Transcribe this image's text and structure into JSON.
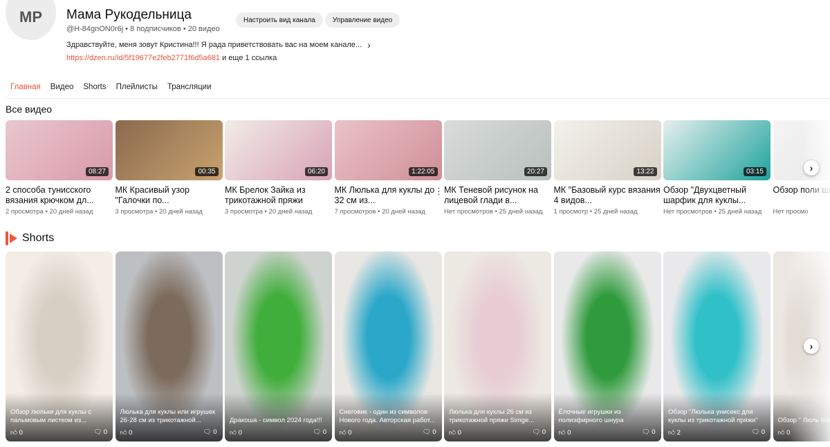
{
  "channel": {
    "initials": "МР",
    "name": "Мама Рукодельница",
    "handle": "@H-84gnON0r6j",
    "subscribers": "8 подписчиков",
    "video_count": "20 видео",
    "description": "Здравствуйте, меня зовут Кристина!!! Я рада приветствовать вас на моем канале...",
    "link": "https://dzen.ru/id/5f19677e2feb2771f6d5a681",
    "more_links": "и еще 1 ссылка",
    "customize_label": "Настроить вид канала",
    "manage_label": "Управление видео"
  },
  "tabs": [
    {
      "label": "Главная",
      "active": true
    },
    {
      "label": "Видео"
    },
    {
      "label": "Shorts"
    },
    {
      "label": "Плейлисты"
    },
    {
      "label": "Трансляции"
    }
  ],
  "videos_section": {
    "title": "Все видео",
    "items": [
      {
        "title": "2 способа тунисского вязания крючком дл...",
        "duration": "08:27",
        "views": "2 просмотра",
        "age": "20 дней назад",
        "colors": [
          "#e9c7cf",
          "#d99aa9"
        ]
      },
      {
        "title": "МК Красивый узор \"Галочки по...",
        "duration": "00:35",
        "views": "3 просмотра",
        "age": "20 дней назад",
        "colors": [
          "#8b6a4e",
          "#c8a36e"
        ]
      },
      {
        "title": "МК Брелок Зайка из трикотажной пряжи",
        "duration": "06:20",
        "views": "3 просмотра",
        "age": "20 дней назад",
        "colors": [
          "#f1ece6",
          "#d9a3b8"
        ]
      },
      {
        "title": "МК Люлька для куклы до 32 см из...",
        "duration": "1:22:05",
        "views": "7 просмотров",
        "age": "20 дней назад",
        "colors": [
          "#eac3c8",
          "#cf8f97"
        ]
      },
      {
        "title": "МК Теневой рисунок на лицевой глади в...",
        "duration": "20:27",
        "views": "Нет просмотров",
        "age": "25 дней назад",
        "colors": [
          "#d8dcda",
          "#b9c0bd"
        ]
      },
      {
        "title": "МК \"Базовый курс вязания 4 видов...",
        "duration": "13:22",
        "views": "1 просмотр",
        "age": "25 дней назад",
        "colors": [
          "#f3f1ec",
          "#d8d2c6"
        ]
      },
      {
        "title": "Обзор \"Двухцветный шарфик для куклы...",
        "duration": "03:15",
        "views": "Нет просмотров",
        "age": "25 дней назад",
        "colors": [
          "#e6efee",
          "#1fa39c"
        ]
      },
      {
        "title": "Обзор поли шнура Дар...",
        "duration": "",
        "views": "Нет просмо",
        "age": "",
        "colors": [
          "#f4f4f4",
          "#e6e6e6"
        ]
      }
    ]
  },
  "shorts_section": {
    "title": "Shorts",
    "items": [
      {
        "title": "Обзор люльки для куклы с пальмовым листком из...",
        "likes": "0",
        "comments": "0",
        "colors": [
          "#f3ede6",
          "#d8cfc4"
        ]
      },
      {
        "title": "Люлька для куклы или игрушек 26-28 см из трикотажной...",
        "likes": "0",
        "comments": "0",
        "colors": [
          "#bdbfc2",
          "#7c6b5c"
        ]
      },
      {
        "title": "Дракоша - символ 2024 года!!!",
        "likes": "0",
        "comments": "0",
        "colors": [
          "#cfd3cf",
          "#3fae3a"
        ]
      },
      {
        "title": "Снеговик - один из символов Нового года. Авторская работ...",
        "likes": "0",
        "comments": "0",
        "colors": [
          "#e8e7e3",
          "#2aa7c9"
        ]
      },
      {
        "title": "Люлька для куклы 26 см из трикотажной пряжи Simge...",
        "likes": "0",
        "comments": "0",
        "colors": [
          "#ece8e2",
          "#e8cdd4"
        ]
      },
      {
        "title": "Ёлочные игрушки из полиэфирного шнура",
        "likes": "0",
        "comments": "0",
        "colors": [
          "#e9e9ea",
          "#2f9b3c"
        ]
      },
      {
        "title": "Обзор \"Люлька унисекс для куклы из трикотажной пряжи\"",
        "likes": "2",
        "comments": "0",
        "colors": [
          "#e9e9eb",
          "#2fc0c8"
        ]
      },
      {
        "title": "Обзор \" Люль Кошечка для",
        "likes": "0",
        "comments": "",
        "colors": [
          "#ece7e2",
          "#d4cbc1"
        ]
      }
    ]
  }
}
